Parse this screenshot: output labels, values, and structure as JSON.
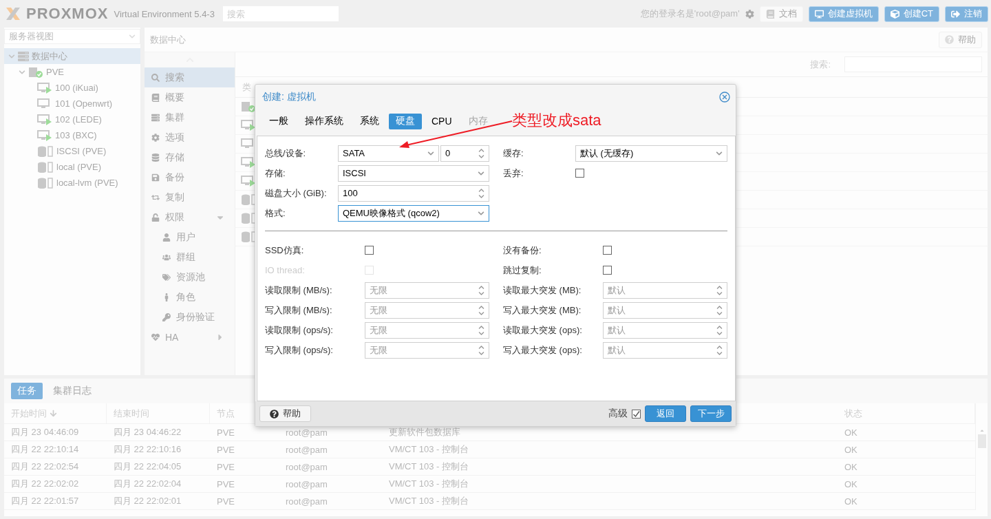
{
  "header": {
    "logo": "PROXMOX",
    "product": "Virtual Environment 5.4-3",
    "search": {
      "placeholder": "搜索"
    },
    "login": "您的登录名是'root@pam'",
    "buttons": [
      {
        "label": "文档",
        "kind": "docs"
      },
      {
        "label": "创建虚拟机",
        "kind": "vm"
      },
      {
        "label": "创建CT",
        "kind": "ct"
      },
      {
        "label": "注销",
        "kind": "logout"
      }
    ]
  },
  "sidebar": {
    "view": "服务器视图",
    "tree": [
      {
        "label": "数据中心",
        "kind": "datacenter",
        "selected": true,
        "expanded": true,
        "children": [
          {
            "label": "PVE",
            "kind": "node",
            "selected": false,
            "expanded": true,
            "children": [
              {
                "label": "100 (iKuai)",
                "kind": "vm",
                "running": true,
                "selected": false
              },
              {
                "label": "101 (Openwrt)",
                "kind": "vm",
                "running": false,
                "selected": false
              },
              {
                "label": "102 (LEDE)",
                "kind": "vm",
                "running": true,
                "selected": false
              },
              {
                "label": "103 (BXC)",
                "kind": "vm",
                "running": true,
                "selected": false
              },
              {
                "label": "ISCSI (PVE)",
                "kind": "storage",
                "selected": false
              },
              {
                "label": "local (PVE)",
                "kind": "storage",
                "selected": false
              },
              {
                "label": "local-lvm (PVE)",
                "kind": "storage",
                "selected": false
              }
            ]
          }
        ]
      }
    ]
  },
  "main": {
    "title": "数据中心",
    "help": "帮助",
    "nav": [
      {
        "label": "搜索",
        "kind": "search",
        "selected": true
      },
      {
        "label": "概要",
        "kind": "summary",
        "selected": false
      },
      {
        "label": "集群",
        "kind": "cluster",
        "selected": false
      },
      {
        "label": "选项",
        "kind": "options",
        "selected": false
      },
      {
        "label": "存储",
        "kind": "storage",
        "selected": false
      },
      {
        "label": "备份",
        "kind": "backup",
        "selected": false
      },
      {
        "label": "复制",
        "kind": "replication",
        "selected": false
      },
      {
        "label": "权限",
        "kind": "permissions",
        "selected": false,
        "expanded": true,
        "children": [
          {
            "label": "用户",
            "kind": "users",
            "selected": false
          },
          {
            "label": "群组",
            "kind": "groups",
            "selected": false
          },
          {
            "label": "资源池",
            "kind": "pools",
            "selected": false
          },
          {
            "label": "角色",
            "kind": "roles",
            "selected": false
          },
          {
            "label": "身份验证",
            "kind": "auth",
            "selected": false
          }
        ]
      },
      {
        "label": "HA",
        "kind": "ha",
        "selected": false,
        "expanded": false
      }
    ],
    "search_label": "搜索:",
    "table": {
      "columns": [
        "类"
      ],
      "rows": [
        {
          "kind": "node"
        },
        {
          "kind": "vm",
          "running": true
        },
        {
          "kind": "vm",
          "running": false
        },
        {
          "kind": "vm",
          "running": true
        },
        {
          "kind": "vm",
          "running": true
        },
        {
          "kind": "storage"
        },
        {
          "kind": "storage"
        },
        {
          "kind": "storage"
        }
      ]
    }
  },
  "tasks": {
    "tabs": [
      {
        "label": "任务",
        "selected": true
      },
      {
        "label": "集群日志",
        "selected": false
      }
    ],
    "columns": [
      {
        "label": "开始时间",
        "sorted": true
      },
      {
        "label": "结束时间",
        "sorted": false
      },
      {
        "label": "节点",
        "sorted": false
      },
      {
        "label": "状态",
        "sorted": false
      }
    ],
    "rows": [
      {
        "start": "四月 23 04:46:09",
        "end": "四月 23 04:46:22",
        "node": "PVE",
        "user": "root@pam",
        "description": "更新软件包数据库",
        "status": "OK"
      },
      {
        "start": "四月 22 22:10:14",
        "end": "四月 22 22:10:16",
        "node": "PVE",
        "user": "root@pam",
        "description": "VM/CT 103 - 控制台",
        "status": "OK"
      },
      {
        "start": "四月 22 22:02:54",
        "end": "四月 22 22:04:05",
        "node": "PVE",
        "user": "root@pam",
        "description": "VM/CT 103 - 控制台",
        "status": "OK"
      },
      {
        "start": "四月 22 22:02:02",
        "end": "四月 22 22:02:04",
        "node": "PVE",
        "user": "root@pam",
        "description": "VM/CT 103 - 控制台",
        "status": "OK"
      },
      {
        "start": "四月 22 22:01:57",
        "end": "四月 22 22:02:01",
        "node": "PVE",
        "user": "root@pam",
        "description": "VM/CT 103 - 控制台",
        "status": "OK"
      }
    ]
  },
  "dialog": {
    "title": "创建: 虚拟机",
    "tabs": [
      {
        "label": "一般",
        "selected": false,
        "disabled": false
      },
      {
        "label": "操作系统",
        "selected": false,
        "disabled": false
      },
      {
        "label": "系统",
        "selected": false,
        "disabled": false
      },
      {
        "label": "硬盘",
        "selected": true,
        "disabled": false
      },
      {
        "label": "CPU",
        "selected": false,
        "disabled": false
      },
      {
        "label": "内存",
        "selected": false,
        "disabled": true
      }
    ],
    "left": [
      {
        "label": "总线/设备:",
        "kind": "bus",
        "value": "SATA",
        "index": "0"
      },
      {
        "label": "存储:",
        "kind": "select",
        "value": "ISCSI",
        "focused": false
      },
      {
        "label": "磁盘大小 (GiB):",
        "kind": "spinner",
        "value": "100"
      },
      {
        "label": "格式:",
        "kind": "select",
        "value": "QEMU映像格式 (qcow2)",
        "focused": true
      }
    ],
    "right": [
      {
        "label": "缓存:",
        "kind": "select",
        "value": "默认 (无缓存)",
        "focused": false
      },
      {
        "label": "丢弃:",
        "kind": "checkbox",
        "checked": false,
        "disabled": false
      }
    ],
    "advanced_left": [
      {
        "label": "SSD仿真:",
        "kind": "checkbox",
        "checked": false,
        "disabled": false
      },
      {
        "label": "IO thread:",
        "kind": "checkbox",
        "checked": false,
        "disabled": true
      },
      {
        "label": "读取限制 (MB/s):",
        "kind": "spinner",
        "placeholder": "无限"
      },
      {
        "label": "写入限制 (MB/s):",
        "kind": "spinner",
        "placeholder": "无限"
      },
      {
        "label": "读取限制 (ops/s):",
        "kind": "spinner",
        "placeholder": "无限"
      },
      {
        "label": "写入限制 (ops/s):",
        "kind": "spinner",
        "placeholder": "无限"
      }
    ],
    "advanced_right": [
      {
        "label": "没有备份:",
        "kind": "checkbox",
        "checked": false,
        "disabled": false
      },
      {
        "label": "跳过复制:",
        "kind": "checkbox",
        "checked": false,
        "disabled": false
      },
      {
        "label": "读取最大突发 (MB):",
        "kind": "spinner",
        "placeholder": "默认"
      },
      {
        "label": "写入最大突发 (MB):",
        "kind": "spinner",
        "placeholder": "默认"
      },
      {
        "label": "读取最大突发 (ops):",
        "kind": "spinner",
        "placeholder": "默认"
      },
      {
        "label": "写入最大突发 (ops):",
        "kind": "spinner",
        "placeholder": "默认"
      }
    ],
    "footer": {
      "help": "帮助",
      "advanced": {
        "label": "高级",
        "checked": true
      },
      "buttons": [
        "返回",
        "下一步"
      ]
    }
  },
  "annotation": {
    "text": "类型改成sata"
  }
}
